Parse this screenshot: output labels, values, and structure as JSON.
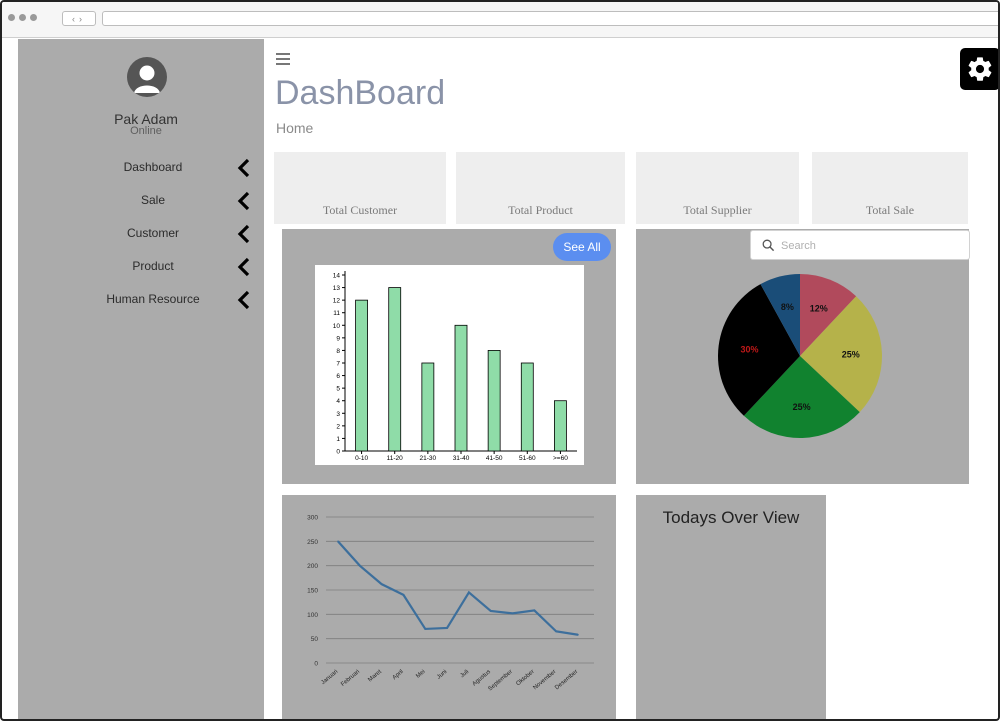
{
  "sidebar": {
    "user_name": "Pak Adam",
    "user_status": "Online",
    "items": [
      {
        "label": "Dashboard"
      },
      {
        "label": "Sale"
      },
      {
        "label": "Customer"
      },
      {
        "label": "Product"
      },
      {
        "label": "Human Resource"
      }
    ]
  },
  "header": {
    "title": "DashBoard",
    "breadcrumb": "Home"
  },
  "stats": [
    {
      "label": "Total Customer"
    },
    {
      "label": "Total Product"
    },
    {
      "label": "Total Supplier"
    },
    {
      "label": "Total Sale"
    }
  ],
  "bar_panel": {
    "see_all_label": "See All"
  },
  "pie_panel": {
    "search_placeholder": "Search"
  },
  "overview": {
    "title": "Todays Over View"
  },
  "colors": {
    "sidebar_bg": "#ababab",
    "card_bg": "#eeeeee",
    "accent": "#5b8ef0",
    "bar_fill": "#8fdca8",
    "line_stroke": "#3d6f9c"
  },
  "chart_data": [
    {
      "type": "bar",
      "categories": [
        "0-10",
        "11-20",
        "21-30",
        "31-40",
        "41-50",
        "51-60",
        ">=60"
      ],
      "values": [
        12,
        13,
        7,
        10,
        8,
        7,
        4
      ],
      "ylim": [
        0,
        14
      ],
      "yticks": [
        0,
        1,
        2,
        3,
        4,
        5,
        6,
        7,
        8,
        9,
        10,
        11,
        12,
        13,
        14
      ],
      "grid": false
    },
    {
      "type": "pie",
      "slices": [
        {
          "label": "12%",
          "value": 12,
          "color": "#b14a5c"
        },
        {
          "label": "25%",
          "value": 25,
          "color": "#b5b24a"
        },
        {
          "label": "25%",
          "value": 25,
          "color": "#11822f"
        },
        {
          "label": "30%",
          "value": 30,
          "color": "#000000"
        },
        {
          "label": "8%",
          "value": 8,
          "color": "#1a4d78"
        }
      ]
    },
    {
      "type": "line",
      "categories": [
        "Januari",
        "Februari",
        "Maret",
        "April",
        "Mei",
        "Juni",
        "Juli",
        "Agustus",
        "September",
        "Oktober",
        "November",
        "Desember"
      ],
      "values": [
        250,
        200,
        162,
        140,
        70,
        72,
        145,
        107,
        102,
        108,
        65,
        58
      ],
      "ylim": [
        0,
        300
      ],
      "yticks": [
        0,
        50,
        100,
        150,
        200,
        250,
        300
      ],
      "grid": true
    }
  ]
}
